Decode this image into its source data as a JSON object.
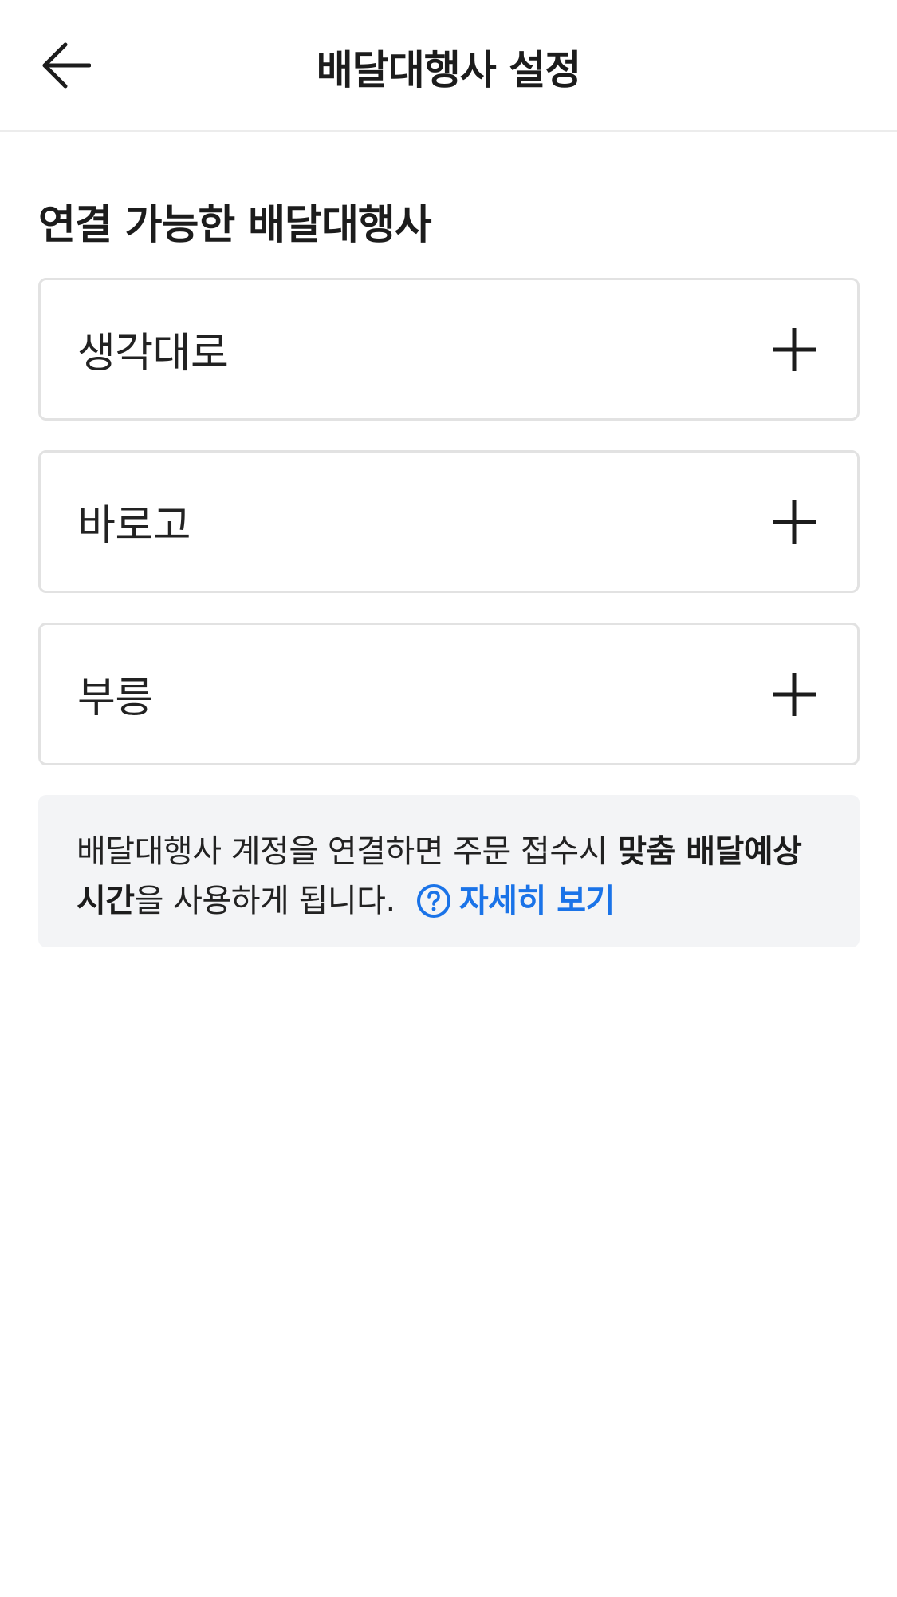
{
  "header": {
    "title": "배달대행사 설정",
    "back_icon": "arrow-left-icon"
  },
  "section": {
    "title": "연결 가능한 배달대행사"
  },
  "agencies": [
    {
      "name": "생각대로",
      "icon": "plus-icon"
    },
    {
      "name": "바로고",
      "icon": "plus-icon"
    },
    {
      "name": "부릉",
      "icon": "plus-icon"
    }
  ],
  "info": {
    "text_part1": "배달대행사 계정을 연결하면 주문 접수시 ",
    "text_bold": "맞춤 배달예상 시간",
    "text_part2": "을 사용하게 됩니다.",
    "link_label": "자세히 보기",
    "link_icon": "question-circle-icon"
  },
  "colors": {
    "link": "#1a73e8",
    "info_background": "#f3f4f6",
    "card_border": "#e2e2e2"
  }
}
